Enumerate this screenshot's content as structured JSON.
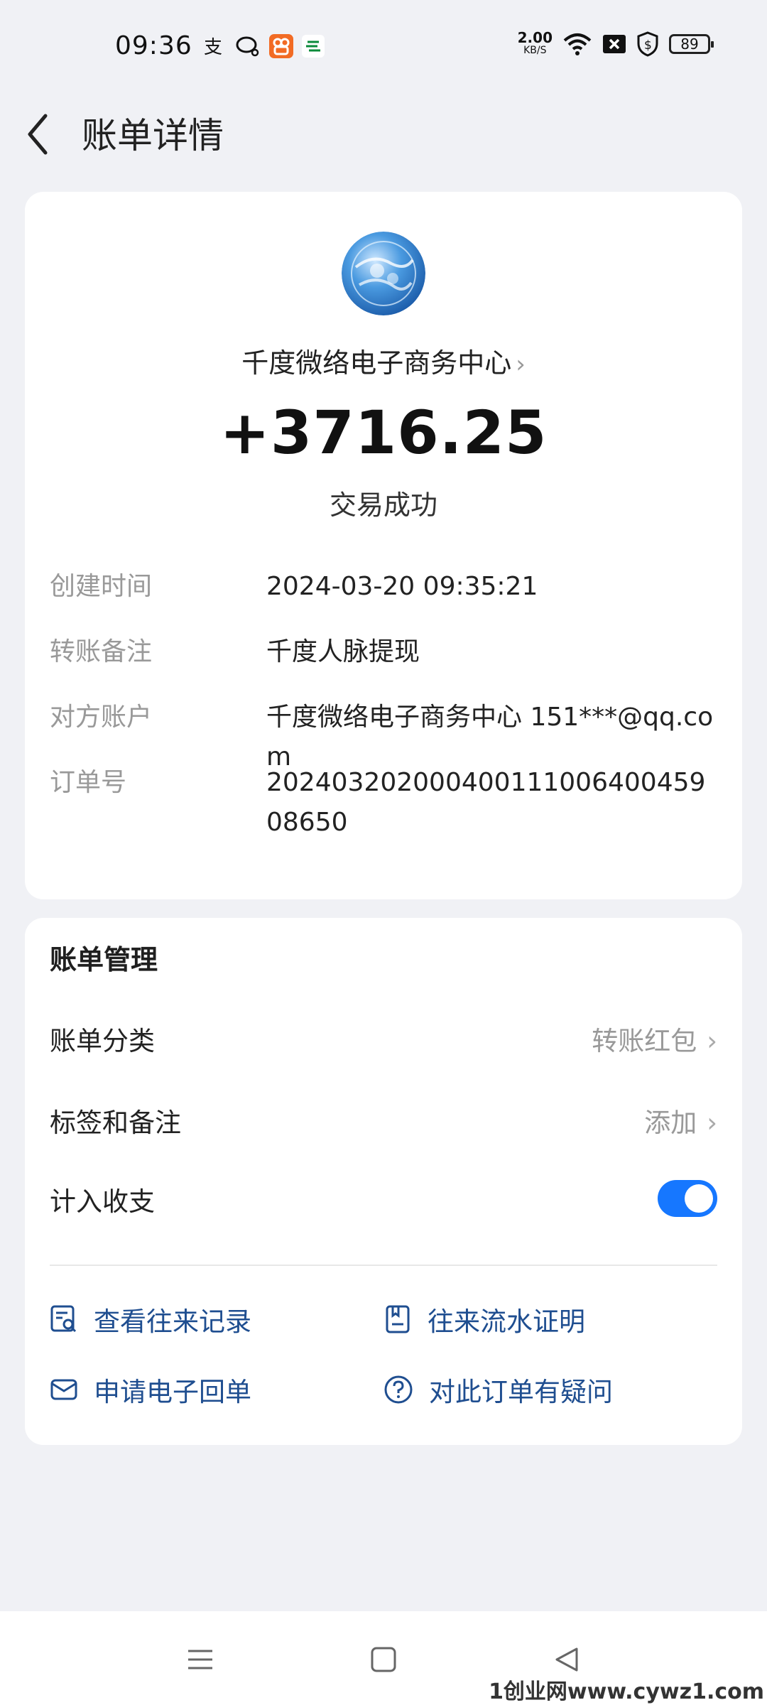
{
  "status_bar": {
    "time": "09:36",
    "net_speed": "2.00",
    "net_unit": "KB/S",
    "battery": "89",
    "icons": [
      "alipay-icon",
      "chat-icon",
      "app-icon",
      "post-icon",
      "wifi-icon",
      "sim-x-icon",
      "shield-dollar-icon",
      "battery-icon"
    ]
  },
  "header": {
    "title": "账单详情"
  },
  "detail": {
    "payee": "千度微络电子商务中心",
    "amount": "+3716.25",
    "status": "交易成功",
    "rows": [
      {
        "label": "创建时间",
        "value": "2024-03-20 09:35:21"
      },
      {
        "label": "转账备注",
        "value": "千度人脉提现"
      },
      {
        "label": "对方账户",
        "value": "千度微络电子商务中心 151***@qq.com"
      },
      {
        "label": "订单号",
        "value": "20240320200040011100640045908650"
      }
    ]
  },
  "management": {
    "title": "账单管理",
    "category_label": "账单分类",
    "category_value": "转账红包",
    "tags_label": "标签和备注",
    "tags_value": "添加",
    "count_label": "计入收支",
    "count_enabled": true,
    "links": [
      {
        "label": "查看往来记录",
        "icon": "records-search-icon"
      },
      {
        "label": "往来流水证明",
        "icon": "statement-icon"
      },
      {
        "label": "申请电子回单",
        "icon": "mail-icon"
      },
      {
        "label": "对此订单有疑问",
        "icon": "question-icon"
      }
    ]
  },
  "watermark": "1创业网www.cywz1.com",
  "colors": {
    "accent": "#1677ff",
    "link": "#1f4e90",
    "background": "#f0f1f5"
  }
}
